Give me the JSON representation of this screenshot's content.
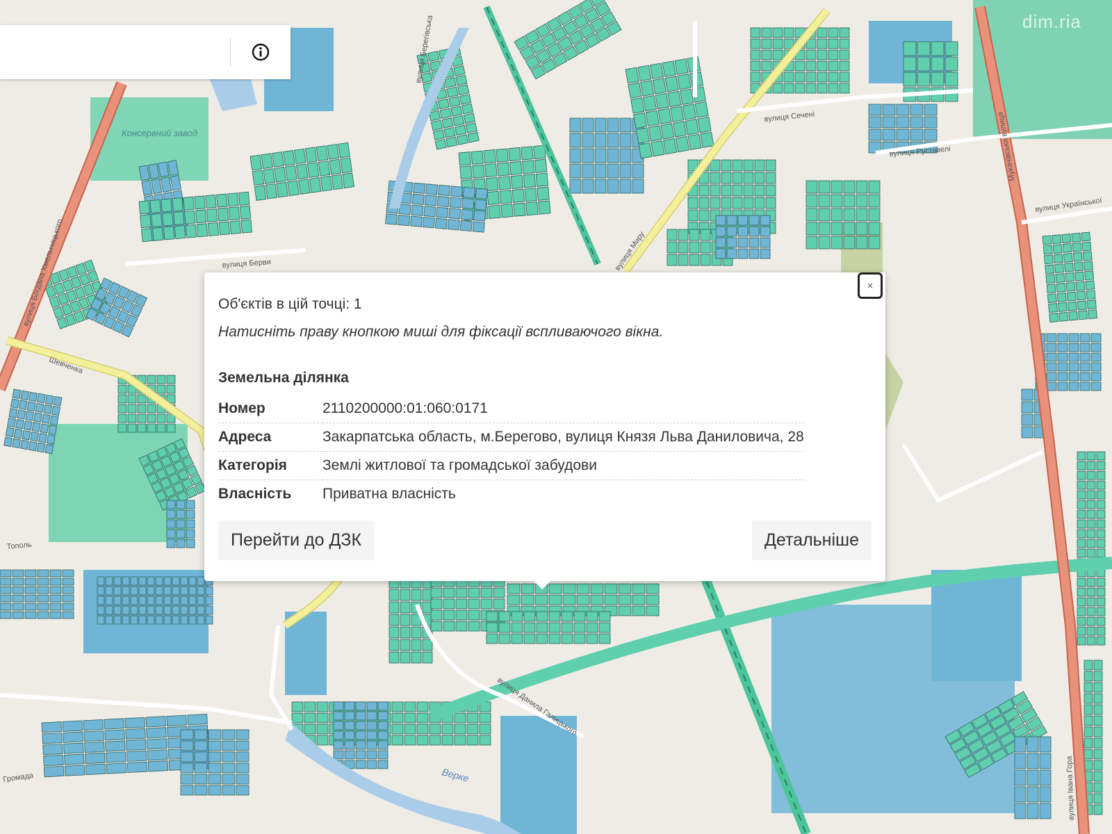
{
  "search": {
    "placeholder": "",
    "value": ""
  },
  "watermark": "dim.ria",
  "map": {
    "colors": {
      "background": "#efece6",
      "parcel_green": "#5fcfae",
      "parcel_blue": "#6fb6d6",
      "parcel_stroke": "#2f5f5a",
      "main_road": "#e8927c",
      "secondary_road": "#f4ef9a",
      "railway": "#4cc49c",
      "water": "#a9cde9",
      "industrial": "#80d6b6"
    },
    "labels": {
      "s1": "вулиця Богдана Хмельницького",
      "s2": "вулиця Берегівська",
      "s3": "вулиця Берви",
      "s4": "вулиця Сечені",
      "s5": "вулиця Руставелі",
      "s6": "вулиця Української",
      "s7": "Мукачівська вулиця",
      "s8": "вулиця Миру",
      "s9": "вулиця Данила Галицького",
      "s10": "вулиця Івана Гора",
      "s11": "Шевченка",
      "s12": "Тополь",
      "place1": "Консервний завод",
      "water1": "Верке",
      "hromada": "Громада"
    }
  },
  "popup": {
    "count_text": "Об'єктів в цій точці: 1",
    "hint_text": "Натисніть праву кнопкою миші для фіксації вспливаючого вікна.",
    "section_title": "Земельна ділянка",
    "rows": [
      {
        "key": "Номер",
        "value": "2110200000:01:060:0171"
      },
      {
        "key": "Адреса",
        "value": "Закарпатська область, м.Берегово, вулиця Князя Льва Даниловича, 28"
      },
      {
        "key": "Категорія",
        "value": "Землі житлової та громадської забудови"
      },
      {
        "key": "Власність",
        "value": "Приватна власність"
      }
    ],
    "close_label": "×",
    "btn_dzk": "Перейти до ДЗК",
    "btn_details": "Детальніше"
  }
}
